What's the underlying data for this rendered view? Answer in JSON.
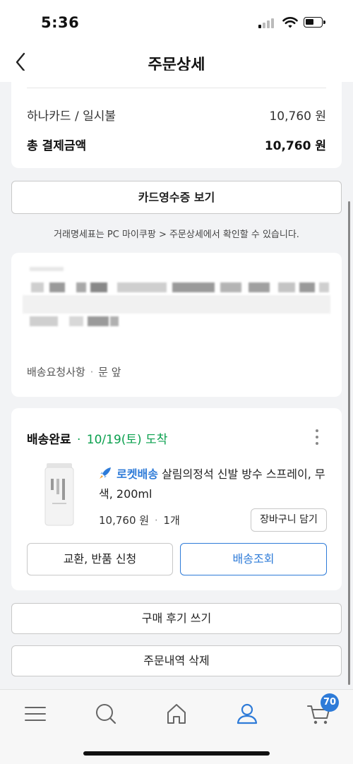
{
  "status_bar": {
    "time": "5:36"
  },
  "header": {
    "title": "주문상세"
  },
  "payment": {
    "method_label": "하나카드 / 일시불",
    "method_amount": "10,760 원",
    "total_label": "총 결제금액",
    "total_amount": "10,760 원"
  },
  "receipt_button": "카드영수증 보기",
  "receipt_note": "거래명세표는 PC 마이쿠팡 > 주문상세에서 확인할 수 있습니다.",
  "address": {
    "request_label": "배송요청사항",
    "request_separator": "·",
    "request_value": "문 앞"
  },
  "delivery": {
    "status": "배송완료",
    "separator": "·",
    "arrival": "10/19(토) 도착",
    "product": {
      "badge": "로켓배송",
      "name": "살림의정석 신발 방수 스프레이, 무색, 200ml",
      "price": "10,760 원",
      "qty_separator": "·",
      "quantity": "1개"
    },
    "cart_button": "장바구니 담기",
    "exchange_button": "교환, 반품 신청",
    "track_button": "배송조회"
  },
  "review_button": "구매 후기 쓰기",
  "delete_button": "주문내역 삭제",
  "bottom_nav": {
    "items": [
      "menu-icon",
      "search-icon",
      "home-icon",
      "user-icon",
      "cart-icon"
    ],
    "active": "user-icon",
    "cart_badge": "70"
  },
  "colors": {
    "accent": "#2e7bd8",
    "delivered_green": "#0aa04e",
    "background": "#f2f3f5"
  }
}
